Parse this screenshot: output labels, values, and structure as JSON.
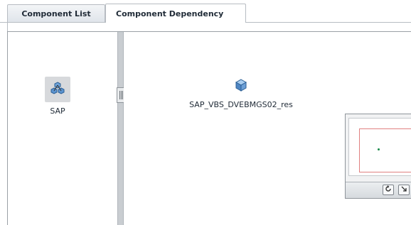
{
  "tabs": [
    {
      "label": "Component List",
      "active": false
    },
    {
      "label": "Component Dependency",
      "active": true
    }
  ],
  "left_pane": {
    "node": {
      "label": "SAP",
      "icon": "cluster-icon",
      "selected": true
    }
  },
  "right_pane": {
    "node": {
      "label": "SAP_VBS_DVEBMGS02_res",
      "icon": "cube-icon"
    }
  },
  "overview": {
    "refresh_icon": "refresh-icon",
    "resize_icon": "resize-diagonal-icon"
  },
  "colors": {
    "accent_blue": "#3b7fc4",
    "viewport_red": "#e08080",
    "dot_green": "#1a8a4a"
  }
}
